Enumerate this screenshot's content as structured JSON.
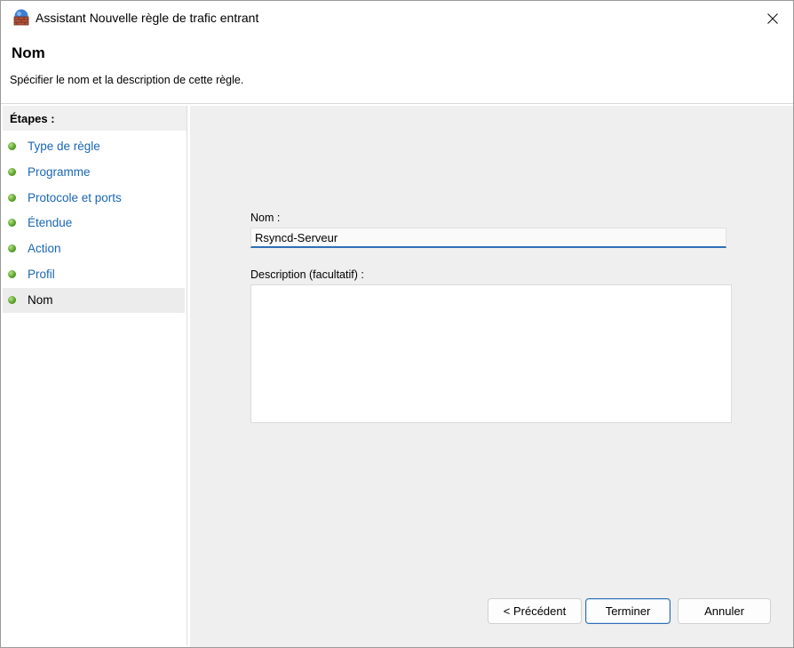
{
  "window": {
    "title": "Assistant Nouvelle règle de trafic entrant"
  },
  "header": {
    "title": "Nom",
    "subtitle": "Spécifier le nom et la description de cette règle."
  },
  "steps": {
    "heading": "Étapes :",
    "items": [
      {
        "label": "Type de règle",
        "current": false
      },
      {
        "label": "Programme",
        "current": false
      },
      {
        "label": "Protocole et ports",
        "current": false
      },
      {
        "label": "Étendue",
        "current": false
      },
      {
        "label": "Action",
        "current": false
      },
      {
        "label": "Profil",
        "current": false
      },
      {
        "label": "Nom",
        "current": true
      }
    ]
  },
  "form": {
    "name_label": "Nom :",
    "name_value": "Rsyncd-Serveur",
    "description_label": "Description (facultatif) :",
    "description_value": ""
  },
  "buttons": {
    "previous": "< Précédent",
    "finish": "Terminer",
    "cancel": "Annuler"
  },
  "colors": {
    "link": "#1a66b5",
    "accent": "#2f6fb5",
    "step_dot": "#5ba32b",
    "pane_bg": "#efefef"
  },
  "icons": {
    "app": "firewall-brick-icon",
    "close": "close-icon",
    "step": "green-dot-icon"
  }
}
